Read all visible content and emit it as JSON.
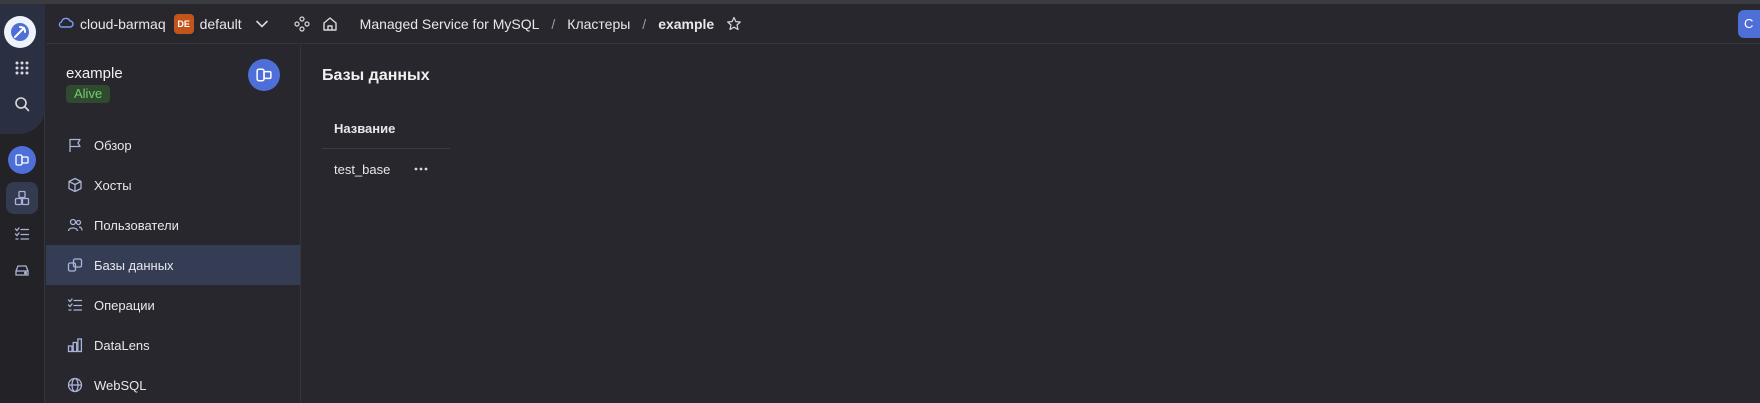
{
  "header": {
    "cloud_name": "cloud-barmaq",
    "folder_badge": "DE",
    "folder_name": "default",
    "breadcrumbs": [
      "Managed Service for MySQL",
      "Кластеры",
      "example"
    ],
    "separator": "/",
    "right_button_label": "С"
  },
  "rail": {
    "icons": [
      "logo-icon",
      "apps-grid-icon",
      "search-icon",
      "mysql-service-icon",
      "clusters-icon",
      "operations-icon",
      "storage-icon"
    ]
  },
  "sidebar": {
    "cluster_name": "example",
    "status": "Alive",
    "items": [
      {
        "label": "Обзор",
        "icon": "flag-icon"
      },
      {
        "label": "Хосты",
        "icon": "cube-icon"
      },
      {
        "label": "Пользователи",
        "icon": "users-icon"
      },
      {
        "label": "Базы данных",
        "icon": "databases-icon",
        "active": true
      },
      {
        "label": "Операции",
        "icon": "list-check-icon"
      },
      {
        "label": "DataLens",
        "icon": "chart-icon"
      },
      {
        "label": "WebSQL",
        "icon": "globe-icon"
      }
    ]
  },
  "main": {
    "title": "Базы данных",
    "table": {
      "columns": [
        "Название"
      ],
      "rows": [
        [
          "test_base"
        ]
      ]
    }
  },
  "colors": {
    "accent": "#4f6fd8",
    "status_green": "#6fcf6f",
    "badge_orange": "#c4551a",
    "background": "#27272d"
  }
}
